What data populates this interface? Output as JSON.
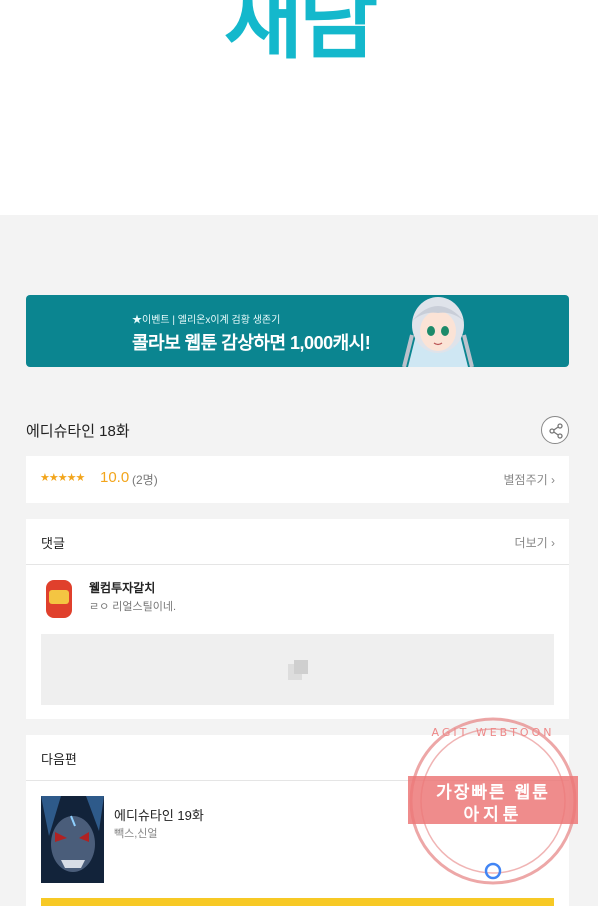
{
  "header": {
    "logo_text": "재담"
  },
  "banner": {
    "subtitle": "★이벤트 | 엘리온x이계 검황 생존기",
    "headline": "콜라보 웹툰 감상하면 1,000캐시!"
  },
  "episode": {
    "title": "에디슈타인 18화"
  },
  "rating": {
    "stars": "★★★★★",
    "score": "10.0",
    "voters": "(2명)",
    "rate_link": "별점주기 ›"
  },
  "comments": {
    "title": "댓글",
    "more": "더보기 ›",
    "items": [
      {
        "user": "웰컴투자갈치",
        "text": "ㄹㅇ 리얼스틸이네."
      }
    ]
  },
  "next": {
    "title": "다음편",
    "episode_title": "에디슈타인 19화",
    "author": "빽스,신얼"
  },
  "watermark": {
    "top_text": "AGIT WEBTOON",
    "line1": "가장빠른 웹툰",
    "line2": "아지툰"
  },
  "colors": {
    "brand": "#14b8cc",
    "banner": "#0b8590",
    "star": "#f2a51c",
    "cta": "#f7c925"
  }
}
